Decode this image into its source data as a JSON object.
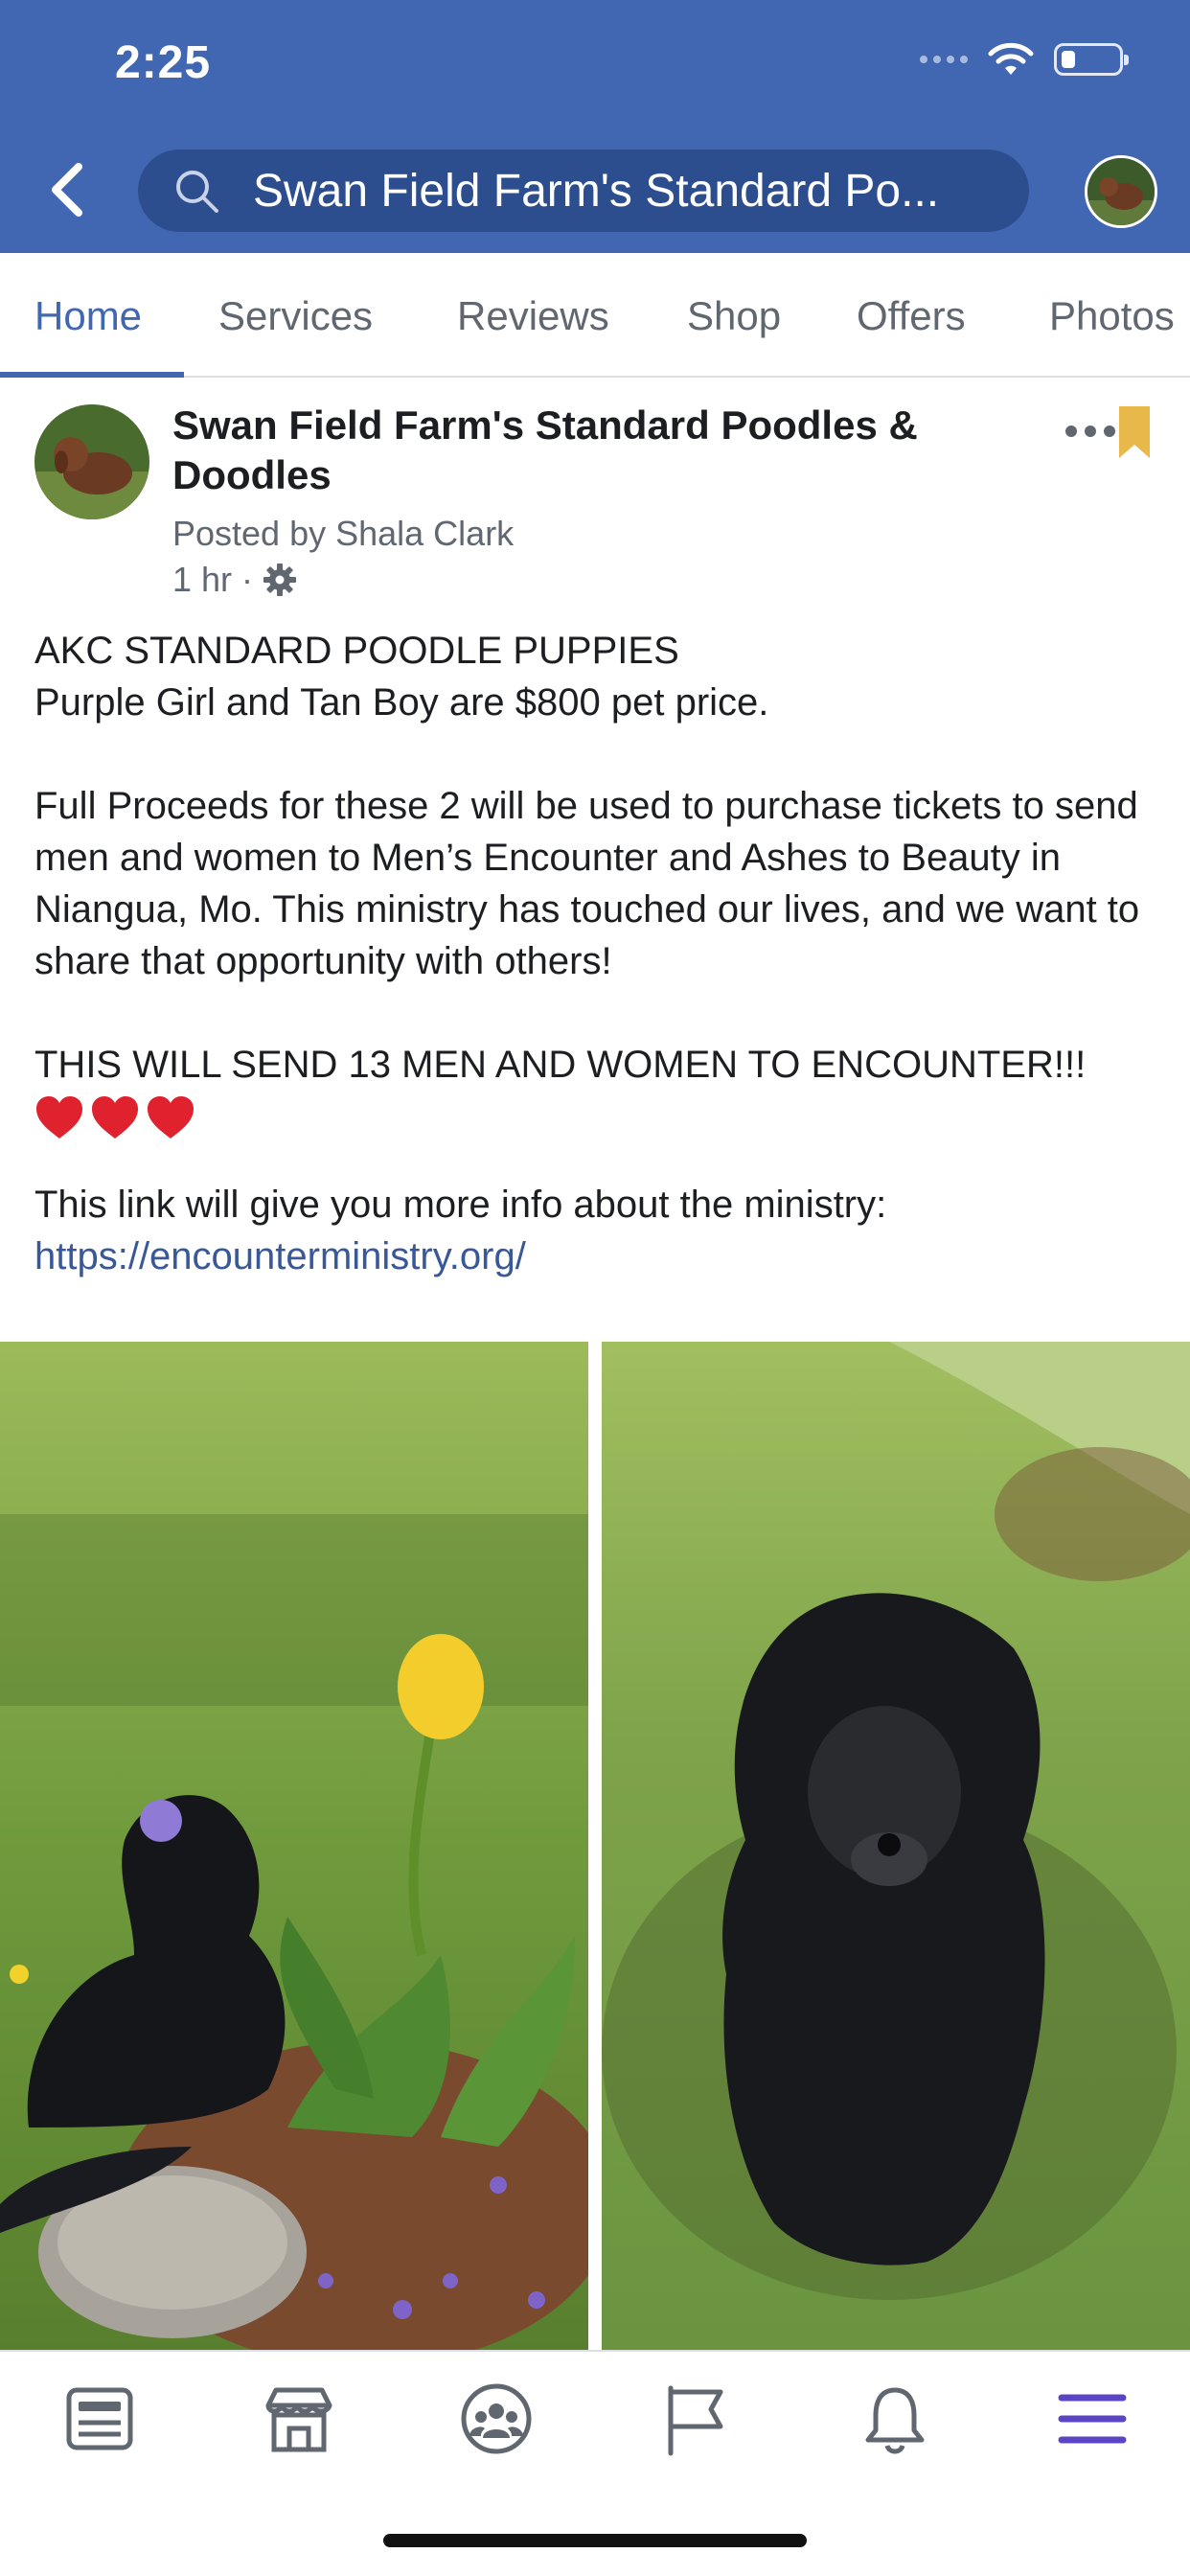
{
  "status_bar": {
    "time": "2:25"
  },
  "header": {
    "search_text": "Swan Field Farm's Standard Po...",
    "back_icon": "chevron-left-icon",
    "search_icon": "search-icon"
  },
  "tabs": [
    {
      "label": "Home",
      "active": true
    },
    {
      "label": "Services",
      "active": false
    },
    {
      "label": "Reviews",
      "active": false
    },
    {
      "label": "Shop",
      "active": false
    },
    {
      "label": "Offers",
      "active": false
    },
    {
      "label": "Photos",
      "active": false
    }
  ],
  "post": {
    "page_name": "Swan Field Farm's Standard Poodles & Doodles",
    "posted_by": "Posted by Shala Clark",
    "time": "1 hr",
    "body": {
      "line1": "AKC STANDARD POODLE PUPPIES",
      "line2": "Purple Girl and Tan Boy are $800 pet price.",
      "para2": "Full Proceeds for these 2 will be used to purchase tickets to send men and women to Men’s Encounter and Ashes to Beauty in Niangua, Mo. This ministry has touched our lives, and we want to share that opportunity with others!",
      "para3": "THIS WILL SEND 13 MEN AND WOMEN TO ENCOUNTER!!!",
      "para4": "This link will give you more info about the ministry:",
      "link": "https://encounterministry.org/"
    }
  },
  "bottom_nav": [
    {
      "icon": "news-feed-icon"
    },
    {
      "icon": "marketplace-icon"
    },
    {
      "icon": "groups-icon"
    },
    {
      "icon": "pages-flag-icon"
    },
    {
      "icon": "notifications-bell-icon"
    },
    {
      "icon": "menu-icon",
      "active": true
    }
  ],
  "colors": {
    "brand": "#4267b2",
    "link": "#385898",
    "active_menu": "#5b45c4"
  }
}
